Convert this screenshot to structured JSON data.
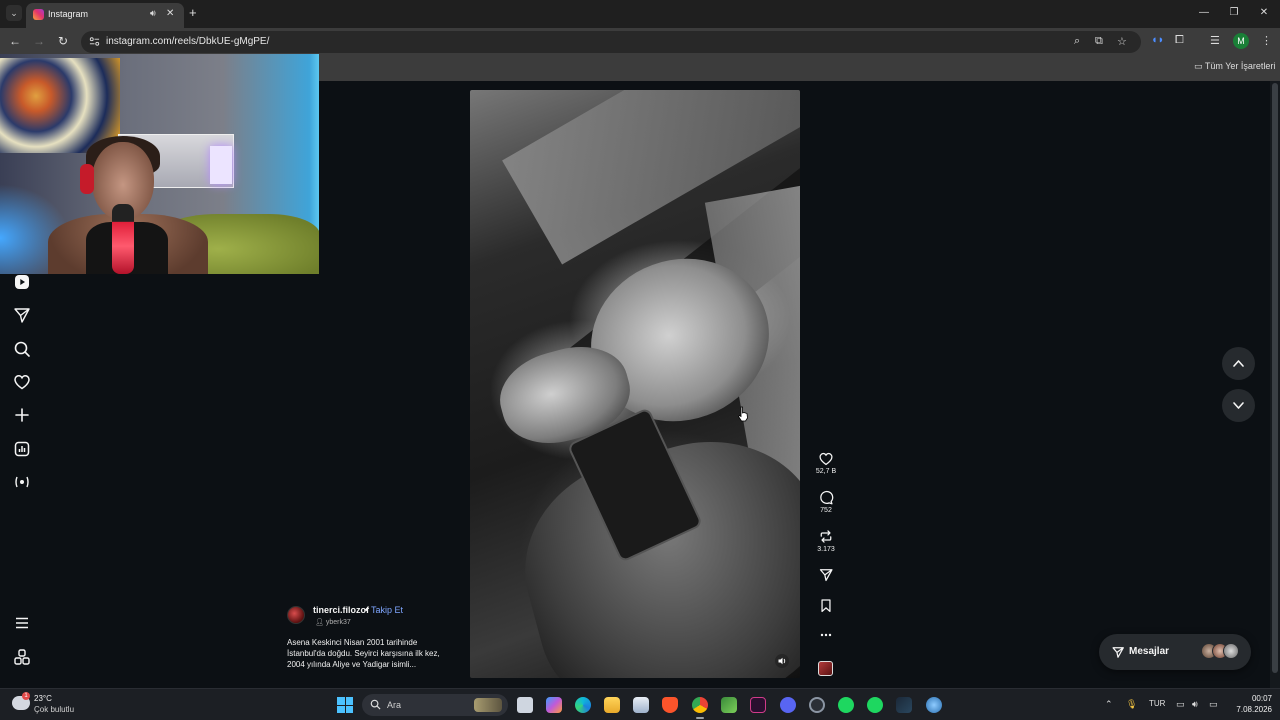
{
  "browser": {
    "tab_title": "Instagram",
    "url": "instagram.com/reels/DbkUE-gMgPE/",
    "bookmarks_folder": "Tüm Yer İşaretleri",
    "profile_initial": "M"
  },
  "reel": {
    "author": "tinerci.filozof",
    "separator": "•",
    "follow_label": "Takip Et",
    "collaborator": "yberk37",
    "caption": "Asena Keskinci Nisan 2001 tarihinde İstanbul'da doğdu. Seyirci karşısına ilk kez, 2004 yılında Aliye ve Yadigar isimli...",
    "likes": "52,7 B",
    "comments": "752",
    "reposts": "3.173"
  },
  "messages": {
    "label": "Mesajlar"
  },
  "taskbar": {
    "temperature": "23°C",
    "weather": "Çok bulutlu",
    "search_placeholder": "Ara",
    "language": "TUR",
    "time": "00:07",
    "date": "7.08.2026",
    "weather_badge": "1"
  },
  "colors": {
    "instagram_bg": "#0c1014",
    "follow_link": "#7fa6ff",
    "windows_accent": "#4cc2ff"
  }
}
